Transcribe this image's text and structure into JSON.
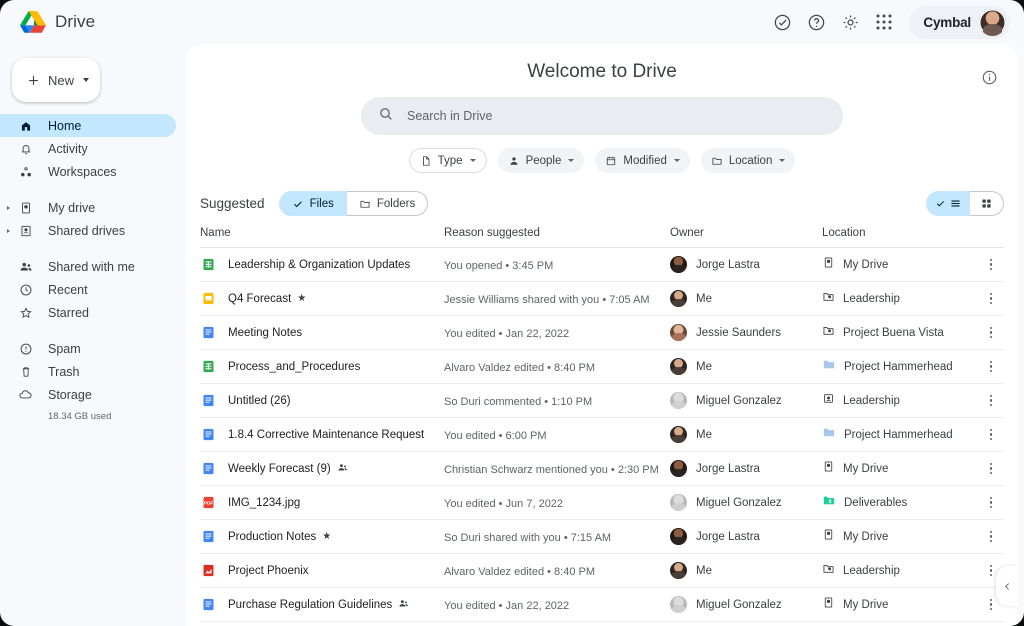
{
  "topbar": {
    "app_title": "Drive",
    "logo_icon": "drive-logo",
    "icons": [
      {
        "name": "check-circle-icon",
        "label": "Tasks"
      },
      {
        "name": "help-icon",
        "label": "Support"
      },
      {
        "name": "gear-icon",
        "label": "Settings"
      },
      {
        "name": "apps-grid-icon",
        "label": "Google apps"
      }
    ],
    "account_name": "Cymbal",
    "avatar_icon": "user-avatar"
  },
  "sidebar": {
    "new_button": {
      "label": "New",
      "plus_icon": "plus-icon",
      "arrow_icon": "chevron-down-icon"
    },
    "items": [
      {
        "label": "Home",
        "icon": "home-icon",
        "active": true,
        "expandable": false
      },
      {
        "label": "Activity",
        "icon": "bell-icon",
        "active": false,
        "expandable": false
      },
      {
        "label": "Workspaces",
        "icon": "workspaces-icon",
        "active": false,
        "expandable": false
      },
      {
        "label": "My drive",
        "icon": "my-drive-icon",
        "active": false,
        "expandable": true
      },
      {
        "label": "Shared drives",
        "icon": "shared-drive-icon",
        "active": false,
        "expandable": true
      },
      {
        "label": "Shared with me",
        "icon": "people-icon",
        "active": false,
        "expandable": false
      },
      {
        "label": "Recent",
        "icon": "clock-icon",
        "active": false,
        "expandable": false
      },
      {
        "label": "Starred",
        "icon": "star-icon",
        "active": false,
        "expandable": false
      },
      {
        "label": "Spam",
        "icon": "spam-icon",
        "active": false,
        "expandable": false
      },
      {
        "label": "Trash",
        "icon": "trash-icon",
        "active": false,
        "expandable": false
      },
      {
        "label": "Storage",
        "icon": "cloud-icon",
        "active": false,
        "expandable": false
      }
    ],
    "storage_used": "18.34 GB used"
  },
  "main": {
    "welcome_title": "Welcome to Drive",
    "info_icon": "info-icon",
    "search": {
      "placeholder": "Search in Drive",
      "value": "",
      "icon": "search-icon"
    },
    "filter_chips": [
      {
        "label": "Type",
        "icon": "file-icon",
        "style": "outlined"
      },
      {
        "label": "People",
        "icon": "person-icon",
        "style": "filled"
      },
      {
        "label": "Modified",
        "icon": "calendar-icon",
        "style": "filled"
      },
      {
        "label": "Location",
        "icon": "folder-icon",
        "style": "filled"
      }
    ],
    "suggested_label": "Suggested",
    "segments": [
      {
        "label": "Files",
        "icon": "check-icon",
        "selected": true
      },
      {
        "label": "Folders",
        "icon": "folder-icon",
        "selected": false
      }
    ],
    "view_toggle": [
      {
        "name": "list-view",
        "icon": "list-icon",
        "selected": true
      },
      {
        "name": "grid-view",
        "icon": "grid-icon",
        "selected": false
      }
    ],
    "columns": [
      "Name",
      "Reason suggested",
      "Owner",
      "Location"
    ],
    "rows": [
      {
        "name": "Leadership & Organization Updates",
        "file_icon": "sheets-icon",
        "starred": false,
        "shared": false,
        "reason": "You opened • 3:45 PM",
        "owner": "Jorge Lastra",
        "owner_avatar": "av-dark",
        "location": "My Drive",
        "location_icon": "my-drive-icon"
      },
      {
        "name": "Q4 Forecast",
        "file_icon": "slides-icon",
        "starred": true,
        "shared": false,
        "reason": "Jessie Williams shared with you • 7:05 AM",
        "owner": "Me",
        "owner_avatar": "av-me",
        "location": "Leadership",
        "location_icon": "shared-drive-icon"
      },
      {
        "name": "Meeting Notes",
        "file_icon": "docs-icon",
        "starred": false,
        "shared": false,
        "reason": "You edited • Jan 22, 2022",
        "owner": "Jessie Saunders",
        "owner_avatar": "av-jessie",
        "location": "Project Buena Vista",
        "location_icon": "shared-drive-icon"
      },
      {
        "name": "Process_and_Procedures",
        "file_icon": "sheets-icon",
        "starred": false,
        "shared": false,
        "reason": "Alvaro Valdez edited • 8:40 PM",
        "owner": "Me",
        "owner_avatar": "av-me",
        "location": "Project Hammerhead",
        "location_icon": "folder-blue-icon"
      },
      {
        "name": "Untitled (26)",
        "file_icon": "docs-icon",
        "starred": false,
        "shared": false,
        "reason": "So Duri commented • 1:10 PM",
        "owner": "Miguel Gonzalez",
        "owner_avatar": "av-miguel",
        "location": "Leadership",
        "location_icon": "shared-drive-alt-icon"
      },
      {
        "name": "1.8.4 Corrective Maintenance Request",
        "file_icon": "docs-icon",
        "starred": false,
        "shared": false,
        "reason": "You edited • 6:00 PM",
        "owner": "Me",
        "owner_avatar": "av-me",
        "location": "Project Hammerhead",
        "location_icon": "folder-blue-icon"
      },
      {
        "name": "Weekly Forecast (9)",
        "file_icon": "docs-icon",
        "starred": false,
        "shared": true,
        "reason": "Christian Schwarz mentioned you • 2:30 PM",
        "owner": "Jorge Lastra",
        "owner_avatar": "av-dark",
        "location": "My Drive",
        "location_icon": "my-drive-icon"
      },
      {
        "name": "IMG_1234.jpg",
        "file_icon": "pdf-icon",
        "starred": false,
        "shared": false,
        "reason": "You edited • Jun 7, 2022",
        "owner": "Miguel Gonzalez",
        "owner_avatar": "av-miguel",
        "location": "Deliverables",
        "location_icon": "folder-green-icon"
      },
      {
        "name": "Production Notes",
        "file_icon": "docs-icon",
        "starred": true,
        "shared": false,
        "reason": "So Duri shared with you • 7:15 AM",
        "owner": "Jorge Lastra",
        "owner_avatar": "av-dark",
        "location": "My Drive",
        "location_icon": "my-drive-icon"
      },
      {
        "name": "Project Phoenix",
        "file_icon": "chart-icon",
        "starred": false,
        "shared": false,
        "reason": "Alvaro Valdez edited • 8:40 PM",
        "owner": "Me",
        "owner_avatar": "av-me",
        "location": "Leadership",
        "location_icon": "shared-drive-icon"
      },
      {
        "name": "Purchase Regulation Guidelines",
        "file_icon": "docs-icon",
        "starred": false,
        "shared": true,
        "reason": "You edited • Jan 22, 2022",
        "owner": "Miguel Gonzalez",
        "owner_avatar": "av-miguel",
        "location": "My Drive",
        "location_icon": "my-drive-icon"
      }
    ],
    "row_menu_icon": "more-vert-icon",
    "collapse_icon": "chevron-left-icon"
  },
  "colors": {
    "accent_blue": "#c2e7ff",
    "sheets_green": "#34a853",
    "docs_blue": "#4285f4",
    "slides_yellow": "#fbbc04",
    "pdf_red": "#ea4335",
    "folder_blue": "#a8c7ed",
    "folder_green": "#1ecf9a",
    "panel_bg": "#ffffff",
    "app_bg": "#f7f9fc"
  }
}
